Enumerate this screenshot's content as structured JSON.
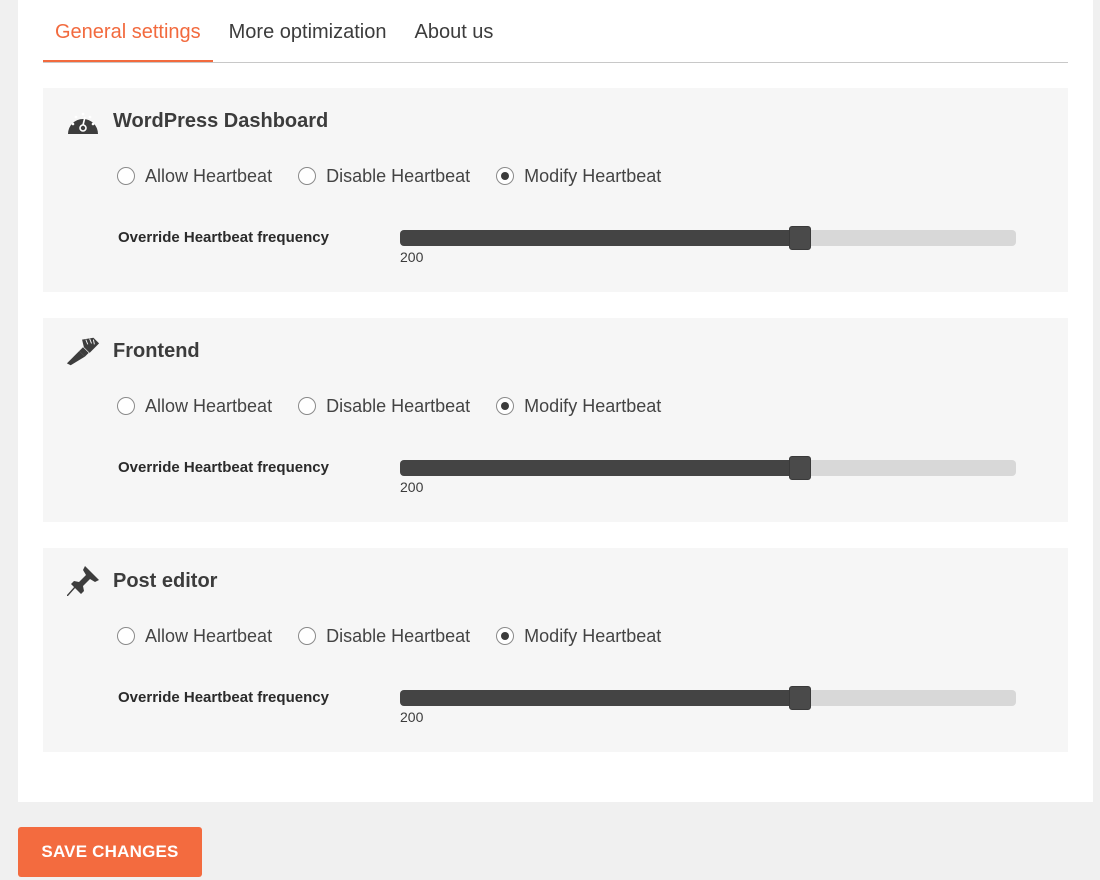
{
  "tabs": [
    {
      "label": "General settings",
      "active": true
    },
    {
      "label": "More optimization",
      "active": false
    },
    {
      "label": "About us",
      "active": false
    }
  ],
  "sections": [
    {
      "icon": "dashboard-gauge-icon",
      "title": "WordPress Dashboard",
      "options": [
        "Allow Heartbeat",
        "Disable Heartbeat",
        "Modify Heartbeat"
      ],
      "selected_option": "Modify Heartbeat",
      "frequency_label": "Override Heartbeat frequency",
      "frequency_value": "200",
      "slider_fraction": 0.649
    },
    {
      "icon": "paintbrush-icon",
      "title": "Frontend",
      "options": [
        "Allow Heartbeat",
        "Disable Heartbeat",
        "Modify Heartbeat"
      ],
      "selected_option": "Modify Heartbeat",
      "frequency_label": "Override Heartbeat frequency",
      "frequency_value": "200",
      "slider_fraction": 0.649
    },
    {
      "icon": "pushpin-icon",
      "title": "Post editor",
      "options": [
        "Allow Heartbeat",
        "Disable Heartbeat",
        "Modify Heartbeat"
      ],
      "selected_option": "Modify Heartbeat",
      "frequency_label": "Override Heartbeat frequency",
      "frequency_value": "200",
      "slider_fraction": 0.649
    }
  ],
  "save_button": {
    "label": "SAVE CHANGES"
  },
  "colors": {
    "accent": "#f26a3e",
    "button": "#f36b3f",
    "slider_fill": "#444444",
    "slider_track": "#d8d8d8",
    "section_bg": "#f6f6f6"
  }
}
